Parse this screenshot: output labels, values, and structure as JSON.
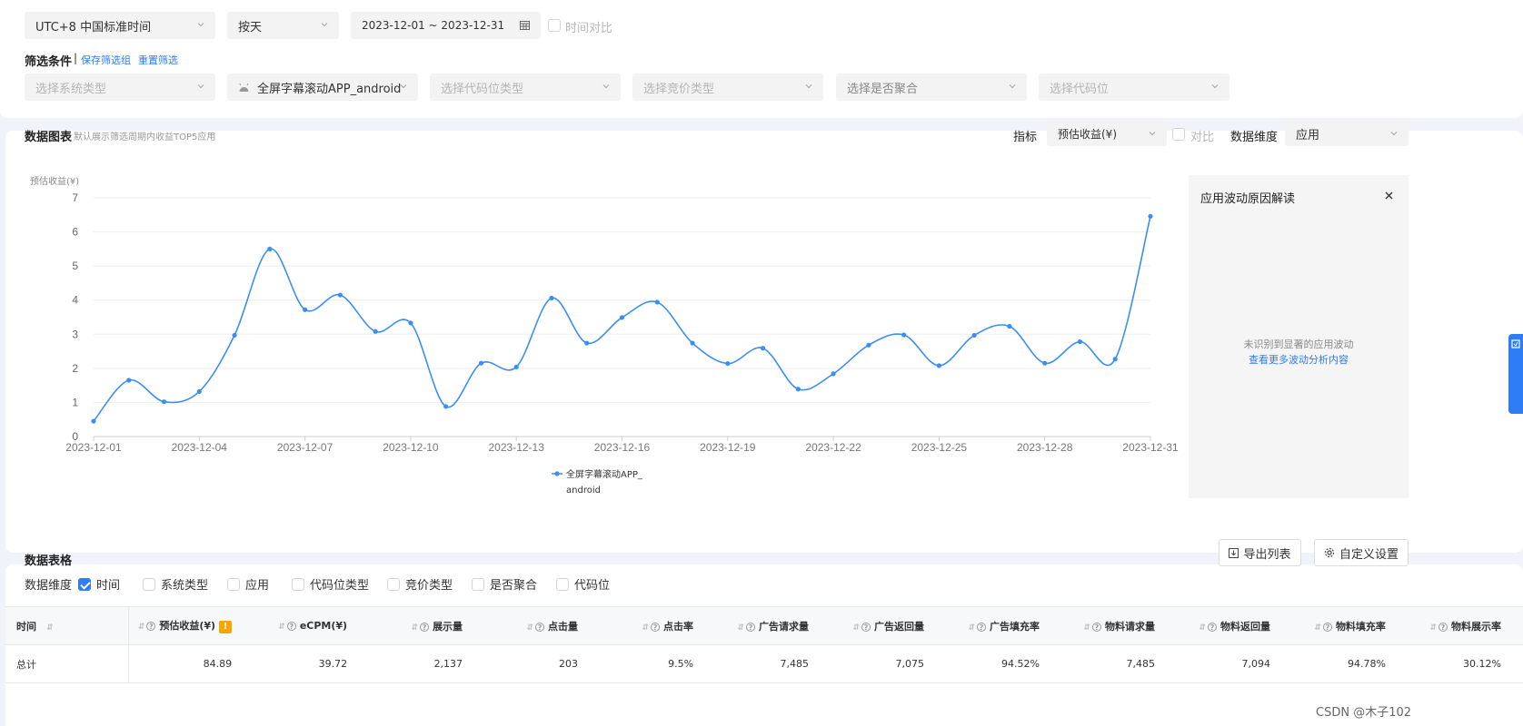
{
  "filters": {
    "timezone": "UTC+8 中国标准时间",
    "granularity": "按天",
    "date_range": "2023-12-01 ~ 2023-12-31",
    "compare_label": "时间对比",
    "condition_title": "筛选条件",
    "save_group": "保存筛选组",
    "reset": "重置筛选",
    "system_type": "选择系统类型",
    "app": "全屏字幕滚动APP_android",
    "code_type": "选择代码位类型",
    "bid_type": "选择竞价类型",
    "aggregate": "选择是否聚合",
    "code_slot": "选择代码位"
  },
  "chart_section": {
    "title": "数据图表",
    "subtitle": "默认展示筛选周期内收益TOP5应用",
    "metric_label": "指标",
    "metric_value": "预估收益(¥)",
    "compare_label": "对比",
    "dimension_label": "数据维度",
    "dimension_value": "应用"
  },
  "chart_data": {
    "type": "line",
    "ylabel": "预估收益(¥)",
    "ylim": [
      0,
      7
    ],
    "yticks": [
      "0",
      "1",
      "2",
      "3",
      "4",
      "5",
      "6",
      "7"
    ],
    "xtick_labels": [
      "2023-12-01",
      "2023-12-04",
      "2023-12-07",
      "2023-12-10",
      "2023-12-13",
      "2023-12-16",
      "2023-12-19",
      "2023-12-22",
      "2023-12-25",
      "2023-12-28",
      "2023-12-31"
    ],
    "x": [
      "2023-12-01",
      "2023-12-02",
      "2023-12-03",
      "2023-12-04",
      "2023-12-05",
      "2023-12-06",
      "2023-12-07",
      "2023-12-08",
      "2023-12-09",
      "2023-12-10",
      "2023-12-11",
      "2023-12-12",
      "2023-12-13",
      "2023-12-14",
      "2023-12-15",
      "2023-12-16",
      "2023-12-17",
      "2023-12-18",
      "2023-12-19",
      "2023-12-20",
      "2023-12-21",
      "2023-12-22",
      "2023-12-23",
      "2023-12-24",
      "2023-12-25",
      "2023-12-26",
      "2023-12-27",
      "2023-12-28",
      "2023-12-29",
      "2023-12-30",
      "2023-12-31"
    ],
    "series": [
      {
        "name": "全屏字幕滚动APP_android",
        "color": "#3a8ef6",
        "values": [
          0.45,
          1.65,
          1.02,
          1.32,
          2.97,
          5.5,
          3.72,
          4.15,
          3.08,
          3.33,
          0.88,
          2.15,
          2.04,
          4.06,
          2.74,
          3.49,
          3.94,
          2.74,
          2.14,
          2.59,
          1.39,
          1.84,
          2.68,
          2.98,
          2.08,
          2.97,
          3.23,
          2.15,
          2.78,
          2.27,
          6.46
        ]
      }
    ],
    "legend_lines": [
      "全屏字幕滚动APP_",
      "android"
    ],
    "grid": true
  },
  "side_panel": {
    "title": "应用波动原因解读",
    "empty_text": "未识别到显著的应用波动",
    "more_link": "查看更多波动分析内容"
  },
  "table_section": {
    "title": "数据表格",
    "export": "导出列表",
    "custom": "自定义设置",
    "dimension_label": "数据维度",
    "dimensions": [
      {
        "label": "时间",
        "checked": true
      },
      {
        "label": "系统类型",
        "checked": false
      },
      {
        "label": "应用",
        "checked": false
      },
      {
        "label": "代码位类型",
        "checked": false
      },
      {
        "label": "竞价类型",
        "checked": false
      },
      {
        "label": "是否聚合",
        "checked": false
      },
      {
        "label": "代码位",
        "checked": false
      }
    ],
    "columns": [
      "时间",
      "预估收益(¥)",
      "eCPM(¥)",
      "展示量",
      "点击量",
      "点击率",
      "广告请求量",
      "广告返回量",
      "广告填充率",
      "物料请求量",
      "物料返回量",
      "物料填充率",
      "物料展示率"
    ],
    "rows": [
      [
        "总计",
        "84.89",
        "39.72",
        "2,137",
        "203",
        "9.5%",
        "7,485",
        "7,075",
        "94.52%",
        "7,485",
        "7,094",
        "94.78%",
        "30.12%"
      ]
    ]
  },
  "watermark": "CSDN @木子102",
  "colors": {
    "accent": "#2e7cf6",
    "line": "#3a8ef6",
    "warning": "#f7a600"
  }
}
